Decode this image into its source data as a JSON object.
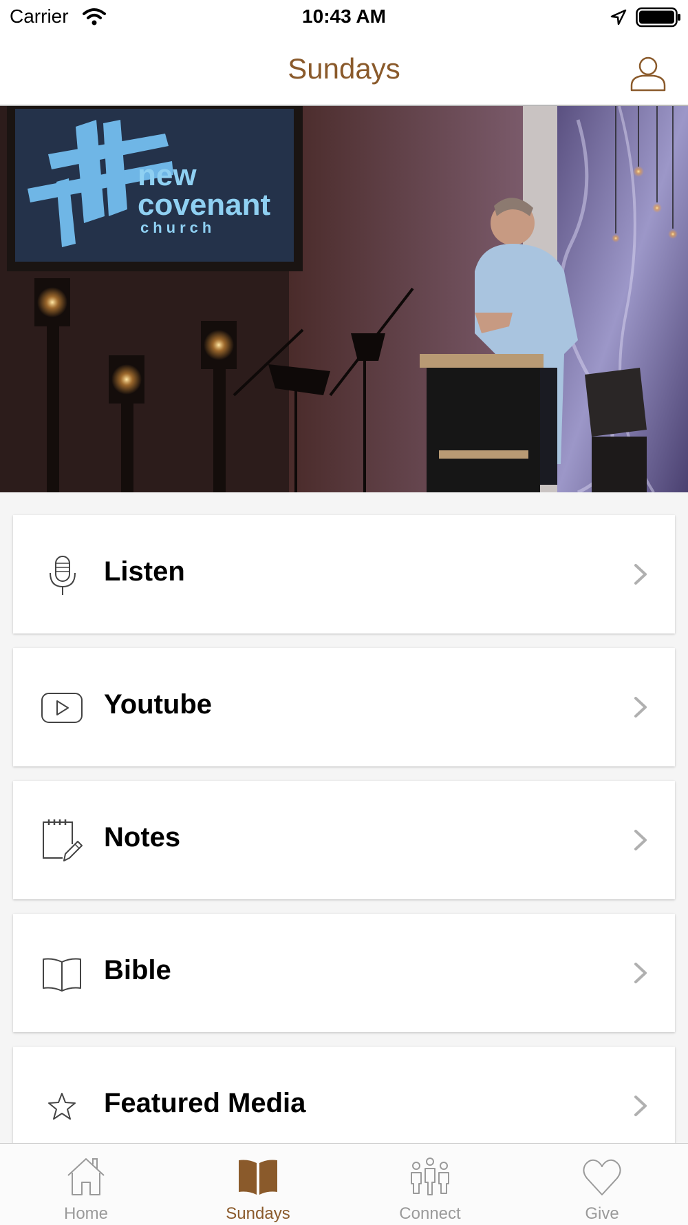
{
  "status_bar": {
    "carrier": "Carrier",
    "time": "10:43 AM"
  },
  "header": {
    "title": "Sundays",
    "profile_icon": "user-icon"
  },
  "hero": {
    "image": "stage-photo",
    "screen_text_line1": "new",
    "screen_text_line2": "covenant",
    "screen_text_line3": "church"
  },
  "menu": {
    "items": [
      {
        "label": "Listen",
        "icon": "microphone-icon"
      },
      {
        "label": "Youtube",
        "icon": "play-icon"
      },
      {
        "label": "Notes",
        "icon": "notepad-icon"
      },
      {
        "label": "Bible",
        "icon": "book-icon"
      },
      {
        "label": "Featured Media",
        "icon": "star-icon"
      }
    ]
  },
  "tab_bar": {
    "tabs": [
      {
        "label": "Home",
        "icon": "home-icon",
        "active": false
      },
      {
        "label": "Sundays",
        "icon": "book-icon",
        "active": true
      },
      {
        "label": "Connect",
        "icon": "people-icon",
        "active": false
      },
      {
        "label": "Give",
        "icon": "heart-icon",
        "active": false
      }
    ]
  },
  "colors": {
    "accent": "#8a5a2b",
    "inactive": "#9a9a9a"
  }
}
